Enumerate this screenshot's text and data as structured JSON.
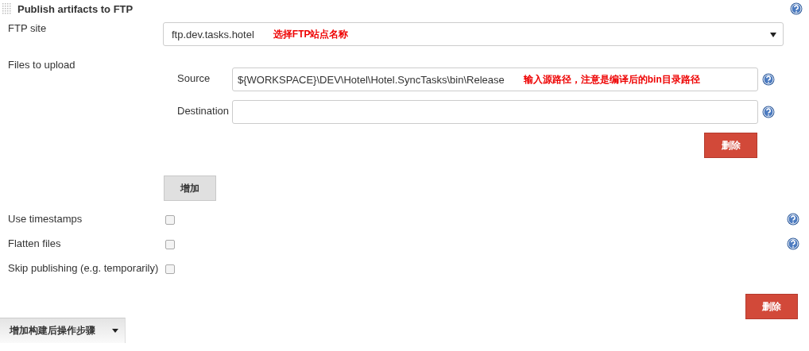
{
  "section": {
    "title": "Publish artifacts to FTP"
  },
  "ftp_site": {
    "label": "FTP site",
    "value": "ftp.dev.tasks.hotel",
    "annotation": "选择FTP站点名称"
  },
  "files_to_upload": {
    "label": "Files to upload",
    "fields": [
      {
        "label": "Source",
        "value": "${WORKSPACE}\\DEV\\Hotel\\Hotel.SyncTasks\\bin\\Release",
        "annotation": "输入源路径，注意是编译后的bin目录路径"
      },
      {
        "label": "Destination"
      }
    ],
    "delete_button": "删除",
    "add_button": "增加"
  },
  "options": [
    {
      "label": "Use timestamps",
      "checked": false,
      "help": true
    },
    {
      "label": "Flatten files",
      "checked": false,
      "help": true
    },
    {
      "label": "Skip publishing (e.g. temporarily)",
      "checked": false,
      "help": false
    }
  ],
  "delete_button": "删除",
  "add_step_button": "增加构建后操作步骤"
}
